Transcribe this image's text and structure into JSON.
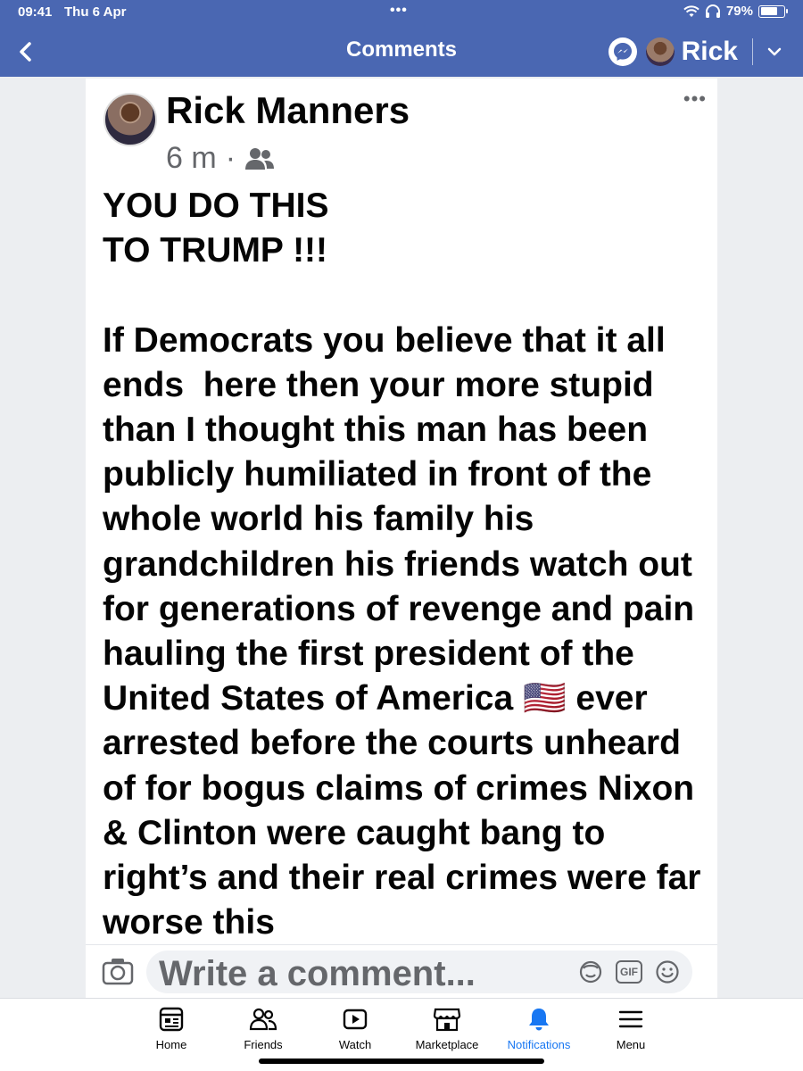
{
  "status_bar": {
    "time": "09:41",
    "date": "Thu 6 Apr",
    "battery": "79%",
    "battery_level": 0.79
  },
  "nav": {
    "title": "Comments",
    "user_name": "Rick"
  },
  "post": {
    "author": "Rick Manners",
    "time_ago": "6 m",
    "separator": "·",
    "text": "YOU DO THIS\nTO TRUMP !!!\n\nIf Democrats you believe that it all ends  here then your more stupid than I thought this man has been publicly humiliated in front of the whole world his family his grandchildren his friends watch out for generations of revenge and pain hauling the first president of the United States of America 🇺🇸 ever arrested before the courts unheard of for bogus claims of crimes Nixon & Clinton were caught bang to right’s and their real crimes were far worse this"
  },
  "comment": {
    "placeholder": "Write a comment...",
    "gif_label": "GIF"
  },
  "tabs": [
    {
      "label": "Home",
      "icon": "home-icon"
    },
    {
      "label": "Friends",
      "icon": "friends-icon"
    },
    {
      "label": "Watch",
      "icon": "watch-icon"
    },
    {
      "label": "Marketplace",
      "icon": "marketplace-icon"
    },
    {
      "label": "Notifications",
      "icon": "bell-icon",
      "active": true
    },
    {
      "label": "Menu",
      "icon": "menu-icon"
    }
  ],
  "colors": {
    "brand_blue": "#4a67b2",
    "active_tab": "#1877f2"
  }
}
